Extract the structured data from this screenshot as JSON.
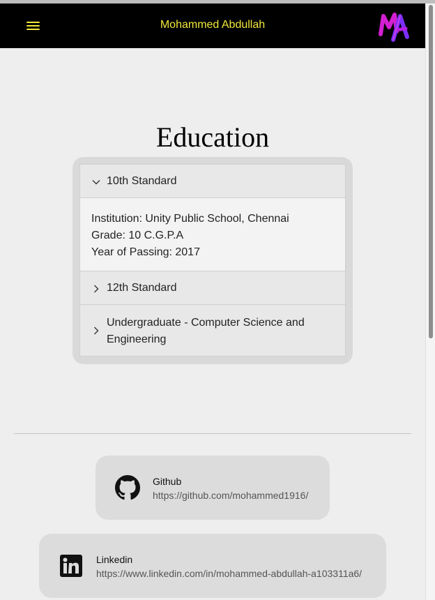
{
  "header": {
    "site_title": "Mohammed Abdullah",
    "logo_text": "MA",
    "menu_icon": "hamburger-menu-icon"
  },
  "education": {
    "title": "Education",
    "items": [
      {
        "label": "10th Standard",
        "expanded": true,
        "details": {
          "institution": "Institution: Unity Public School, Chennai",
          "grade": "Grade: 10 C.G.P.A",
          "year": "Year of Passing: 2017"
        }
      },
      {
        "label": "12th Standard",
        "expanded": false
      },
      {
        "label": "Undergraduate - Computer Science and Engineering",
        "expanded": false
      }
    ]
  },
  "social": [
    {
      "name": "Github",
      "url": "https://github.com/mohammed1916/",
      "icon": "github-icon"
    },
    {
      "name": "Linkedin",
      "url": "https://www.linkedin.com/in/mohammed-abdullah-a103311a6/",
      "icon": "linkedin-icon"
    }
  ],
  "colors": {
    "header_bg": "#000000",
    "accent_yellow": "#f2e83b",
    "page_bg": "#eeeeee",
    "logo_magenta": "#d21fd1",
    "logo_purple": "#7b2ff7"
  }
}
